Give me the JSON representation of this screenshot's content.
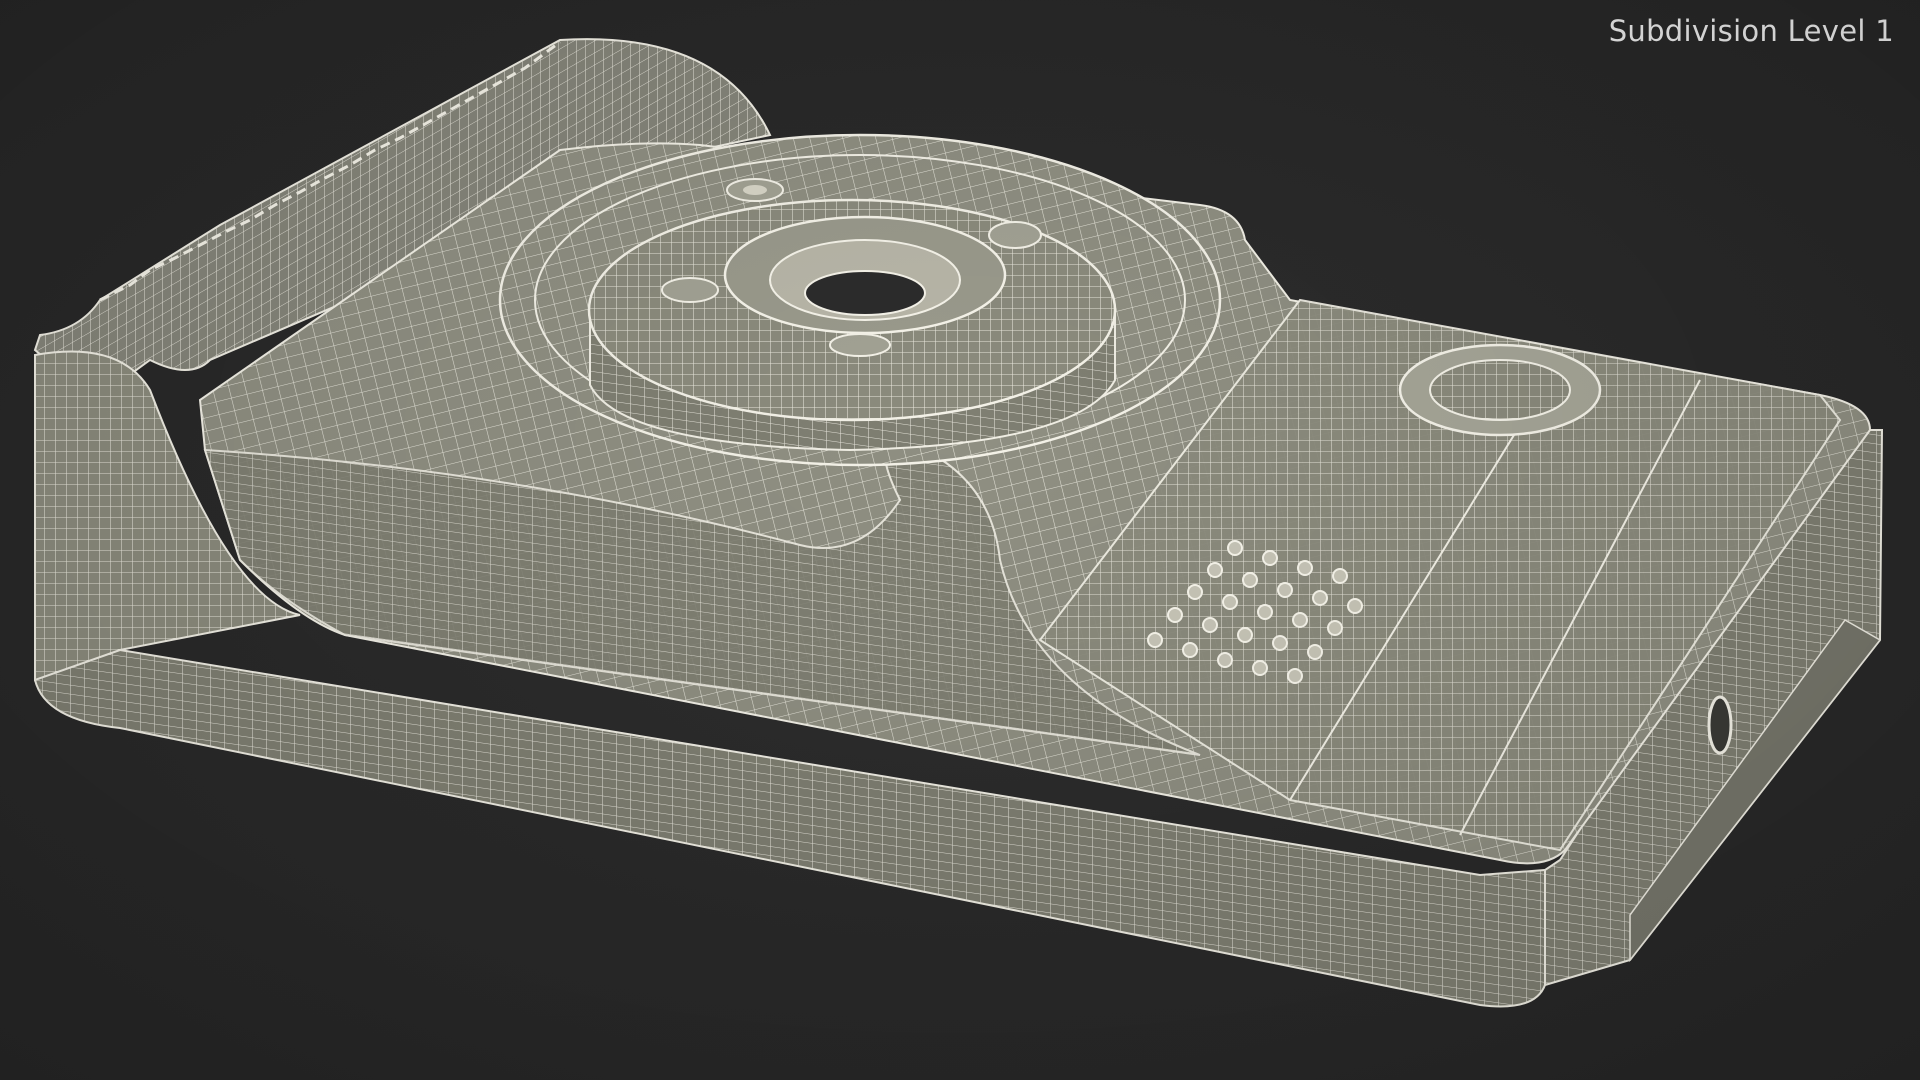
{
  "viewport": {
    "label": "Subdivision Level 1",
    "background_color": "#2a2a2a",
    "mesh_fill_color": "#8b8b7d",
    "wire_color": "#f2f0e6"
  }
}
